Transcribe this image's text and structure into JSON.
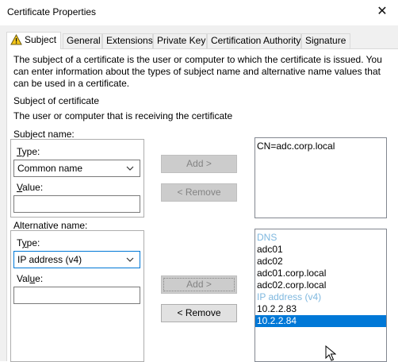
{
  "window": {
    "title": "Certificate Properties",
    "close_glyph": "✕"
  },
  "tabs": [
    {
      "label": "Subject",
      "active": true
    },
    {
      "label": "General"
    },
    {
      "label": "Extensions"
    },
    {
      "label": "Private Key"
    },
    {
      "label": "Certification Authority"
    },
    {
      "label": "Signature"
    }
  ],
  "intro": {
    "line1": "The subject of a certificate is the user or computer to which the certificate is issued. You",
    "line2": "can enter information about the types of subject name and alternative name values that",
    "line3": "can be used in a certificate."
  },
  "subject_of_certificate": {
    "heading": "Subject of certificate",
    "description": "The user or computer that is receiving the certificate"
  },
  "subject_name": {
    "group_label": "Subject name:",
    "type_label_prefix": "T",
    "type_label_rest": "ype:",
    "type_value": "Common name",
    "value_label_prefix": "V",
    "value_label_rest": "alue:",
    "value_text": "",
    "add_button": "Add >",
    "remove_button": "< Remove",
    "list": [
      "CN=adc.corp.local"
    ]
  },
  "alternative_name": {
    "group_label": "Alternative name:",
    "type_label_prefix": "T",
    "type_label_accel": "y",
    "type_label_rest": "pe:",
    "type_value": "IP address (v4)",
    "value_label_prefix": "Val",
    "value_label_accel": "u",
    "value_label_rest": "e:",
    "value_text": "",
    "add_button": "Add >",
    "remove_button": "< Remove",
    "list": [
      {
        "text": "DNS",
        "kind": "header"
      },
      {
        "text": "adc01",
        "kind": "item"
      },
      {
        "text": "adc02",
        "kind": "item"
      },
      {
        "text": "adc01.corp.local",
        "kind": "item"
      },
      {
        "text": "adc02.corp.local",
        "kind": "item"
      },
      {
        "text": "IP address (v4)",
        "kind": "header"
      },
      {
        "text": "10.2.2.83",
        "kind": "item"
      },
      {
        "text": "10.2.2.84",
        "kind": "selected"
      }
    ]
  },
  "colors": {
    "selection": "#0078d7",
    "list_header": "#7fb8df",
    "warning_icon": "#f4c61a"
  },
  "icons": {
    "tab_icon": "warning-icon",
    "dropdown": "chevron-down-icon",
    "pointer": "mouse-cursor-icon"
  }
}
